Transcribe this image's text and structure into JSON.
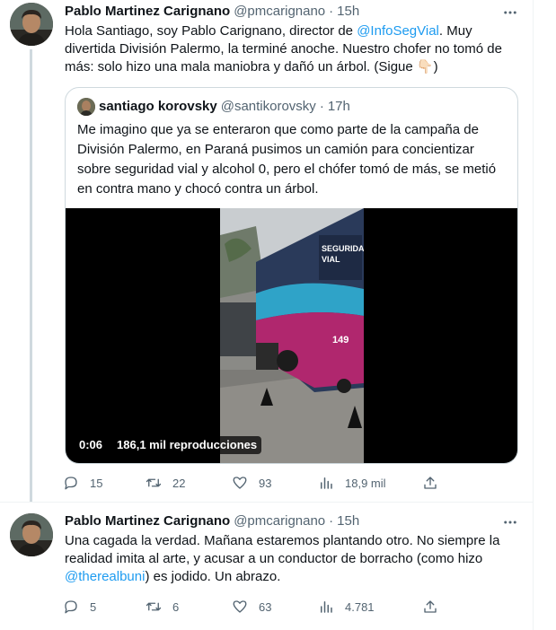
{
  "tweets": [
    {
      "name": "Pablo Martinez Carignano",
      "handle": "@pmcarignano",
      "separator": "·",
      "time": "15h",
      "text_parts": {
        "before": "Hola Santiago, soy Pablo Carignano, director de ",
        "mention": "@InfoSegVial",
        "after": ". Muy divertida División Palermo, la terminé anoche. Nuestro chofer no tomó de más: solo hizo una mala maniobra y dañó un árbol. (Sigue 👇🏻)"
      },
      "quote": {
        "name": "santiago korovsky",
        "handle": "@santikorovsky",
        "separator": "·",
        "time": "17h",
        "text": "Me imagino que ya se enteraron que como parte de la campaña de División Palermo, en Paraná pusimos un camión para concientizar sobre seguridad vial y alcohol 0, pero el chófer tomó de más, se metió en contra mano y chocó contra un árbol.",
        "video": {
          "duration": "0:06",
          "views": "186,1 mil reproducciones",
          "bus_label_1": "SEGURIDAD",
          "bus_label_2": "VIAL",
          "bus_number": "149"
        }
      },
      "actions": {
        "replies": "15",
        "retweets": "22",
        "likes": "93",
        "views": "18,9 mil"
      }
    },
    {
      "name": "Pablo Martinez Carignano",
      "handle": "@pmcarignano",
      "separator": "·",
      "time": "15h",
      "text_parts": {
        "before": "Una cagada la verdad. Mañana estaremos plantando otro. No siempre la realidad imita al arte, y acusar a un conductor de borracho (como hizo ",
        "mention": "@therealbuni",
        "after": ") es jodido. Un abrazo."
      },
      "actions": {
        "replies": "5",
        "retweets": "6",
        "likes": "63",
        "views": "4.781"
      }
    }
  ],
  "icons": {
    "more": "more-horizontal-icon",
    "reply": "reply-bubble-icon",
    "retweet": "retweet-icon",
    "like": "heart-icon",
    "views": "views-chart-icon",
    "share": "share-upload-icon"
  },
  "colors": {
    "link": "#1d9bf0",
    "muted": "#536471",
    "text": "#0f1419",
    "border": "#cfd9de"
  }
}
